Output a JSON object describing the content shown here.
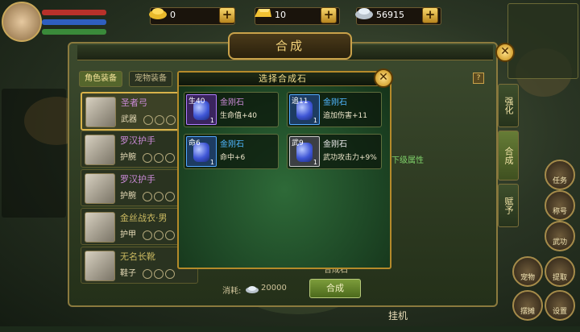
{
  "currency": {
    "gold_ingot": "0",
    "gold_bar": "10",
    "silver": "56915"
  },
  "panel": {
    "title": "合成",
    "tabs": [
      "角色装备",
      "宠物装备"
    ],
    "help_label": "?",
    "side_tabs": [
      "强化",
      "合成",
      "赋予"
    ],
    "cost_label": "消耗:",
    "cost_value": "20000",
    "combine_button": "合成",
    "stone_slot_label": "合成石",
    "hint_label": "下级属性"
  },
  "equipment": [
    {
      "name": "圣者弓",
      "type": "武器"
    },
    {
      "name": "罗汉护手",
      "type": "护腕"
    },
    {
      "name": "罗汉护手",
      "type": "护腕"
    },
    {
      "name": "金丝战衣·男",
      "type": "护甲"
    },
    {
      "name": "无名长靴",
      "type": "鞋子"
    }
  ],
  "popup": {
    "title": "选择合成石",
    "stones": [
      {
        "tag": "生40",
        "name": "金刚石",
        "attr": "生命值+40",
        "count": "1",
        "color": "#c98ad6",
        "rarity": "purple"
      },
      {
        "tag": "追11",
        "name": "金刚石",
        "attr": "追加伤害+11",
        "count": "1",
        "color": "#4fb6ff",
        "rarity": "blue"
      },
      {
        "tag": "命6",
        "name": "金刚石",
        "attr": "命中+6",
        "count": "1",
        "color": "#4fb6ff",
        "rarity": "blue"
      },
      {
        "tag": "武9",
        "name": "金刚石",
        "attr": "武功攻击力+9%",
        "count": "1",
        "color": "#e8e8e8",
        "rarity": "gray"
      }
    ]
  },
  "hud": {
    "bottom_center": "挂机",
    "right_buttons": [
      "任务",
      "称号",
      "武功",
      "宠物",
      "设置",
      "摆摊",
      "提取"
    ]
  }
}
